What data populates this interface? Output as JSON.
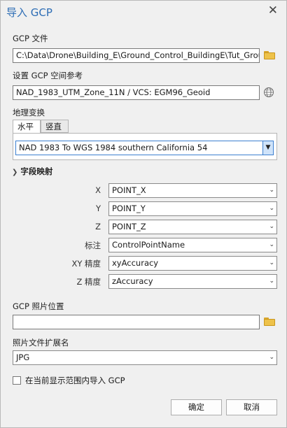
{
  "dialog": {
    "title": "导入 GCP",
    "gcp_file": {
      "label": "GCP 文件",
      "value": "C:\\Data\\Drone\\Building_E\\Ground_Control_BuildingE\\Tut_GroundControl"
    },
    "spatial_ref": {
      "label": "设置 GCP 空间参考",
      "value": "NAD_1983_UTM_Zone_11N / VCS: EGM96_Geoid"
    },
    "geo_transform": {
      "label": "地理变换",
      "tabs": [
        "水平",
        "竖直"
      ],
      "active_tab": "水平",
      "value": "NAD 1983 To WGS 1984 southern California 54"
    },
    "field_mapping": {
      "section_label": "字段映射",
      "rows": [
        {
          "label": "X",
          "value": "POINT_X"
        },
        {
          "label": "Y",
          "value": "POINT_Y"
        },
        {
          "label": "Z",
          "value": "POINT_Z"
        },
        {
          "label": "标注",
          "value": "ControlPointName"
        },
        {
          "label": "XY 精度",
          "value": "xyAccuracy"
        },
        {
          "label": "Z 精度",
          "value": "zAccuracy"
        }
      ]
    },
    "photo_location": {
      "label": "GCP 照片位置",
      "value": ""
    },
    "photo_ext": {
      "label": "照片文件扩展名",
      "value": "JPG"
    },
    "import_extent": {
      "label": "在当前显示范围内导入 GCP",
      "checked": false
    },
    "ok_label": "确定",
    "cancel_label": "取消"
  }
}
